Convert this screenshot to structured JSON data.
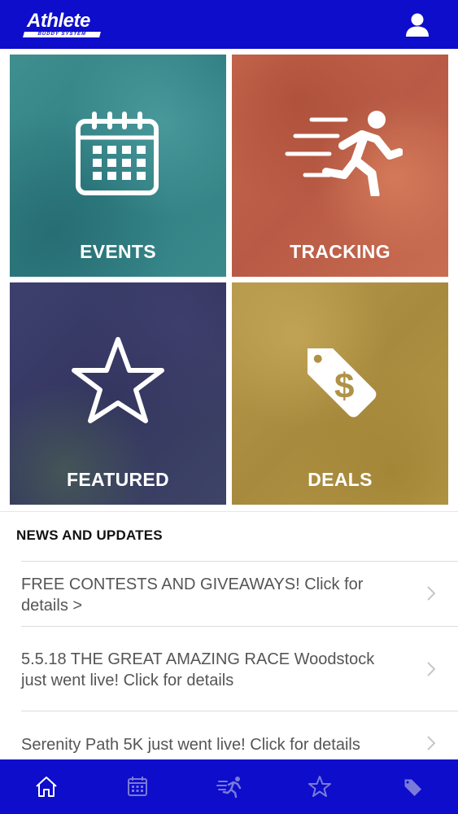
{
  "header": {
    "logo_text": "Athlete",
    "logo_subtext": "BUDDY SYSTEM"
  },
  "tiles": [
    {
      "label": "EVENTS",
      "icon": "calendar-icon"
    },
    {
      "label": "TRACKING",
      "icon": "runner-icon"
    },
    {
      "label": "FEATURED",
      "icon": "star-icon"
    },
    {
      "label": "DEALS",
      "icon": "price-tag-icon"
    }
  ],
  "news": {
    "heading": "NEWS AND UPDATES",
    "items": [
      {
        "text": "FREE CONTESTS AND GIVEAWAYS! Click for details >"
      },
      {
        "text": "5.5.18 THE GREAT AMAZING RACE Woodstock just went live! Click for details"
      },
      {
        "text": "Serenity Path 5K just went live! Click for details"
      }
    ]
  },
  "bottom_nav": {
    "items": [
      "home-icon",
      "calendar-icon",
      "runner-icon",
      "star-icon",
      "price-tag-icon"
    ],
    "active": "home-icon"
  },
  "colors": {
    "brand_blue": "#0d0dcb",
    "events": "#3a8a8c",
    "tracking": "#c0624b",
    "featured": "#3a3c68",
    "deals": "#b09246"
  }
}
